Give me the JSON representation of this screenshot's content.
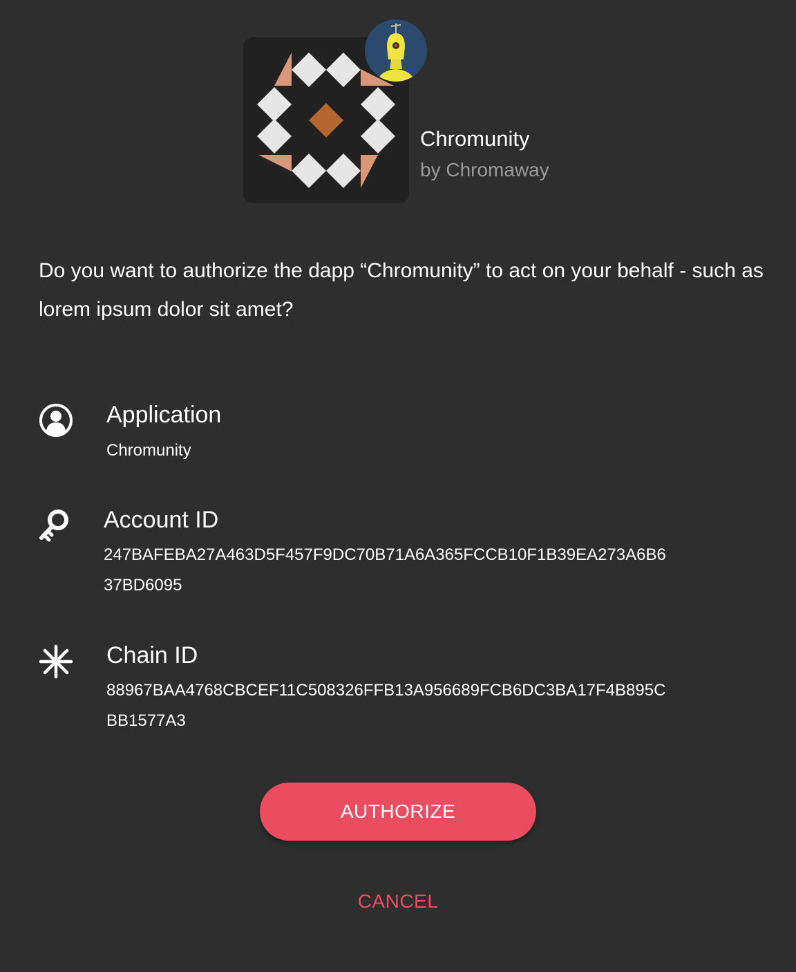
{
  "dapp": {
    "name": "Chromunity",
    "author": "by Chromaway",
    "logo_icon": "chromunity-logo-icon",
    "avatar_icon": "robot-avatar-icon"
  },
  "question": "Do you want to authorize the dapp “Chromunity” to act on your behalf - such as lorem ipsum dolor sit amet?",
  "details": {
    "application": {
      "icon": "user-circle-icon",
      "label": "Application",
      "value": "Chromunity"
    },
    "account": {
      "icon": "key-icon",
      "label": "Account ID",
      "value": "247BAFEBA27A463D5F457F9DC70B71A6A365FCCB10F1B39EA273A6B637BD6095"
    },
    "chain": {
      "icon": "asterisk-icon",
      "label": "Chain ID",
      "value": "88967BAA4768CBCEF11C508326FFB13A956689FCB6DC3BA17F4B895CBB1577A3"
    }
  },
  "actions": {
    "authorize_label": "AUTHORIZE",
    "cancel_label": "CANCEL"
  },
  "colors": {
    "background": "#2e2e2e",
    "accent": "#ea4c60",
    "muted_text": "#9a9a9a",
    "logo_tile": "#212121",
    "logo_diamond": "#e6e6e6",
    "logo_center": "#b5652f",
    "logo_corner": "#d9987a"
  }
}
